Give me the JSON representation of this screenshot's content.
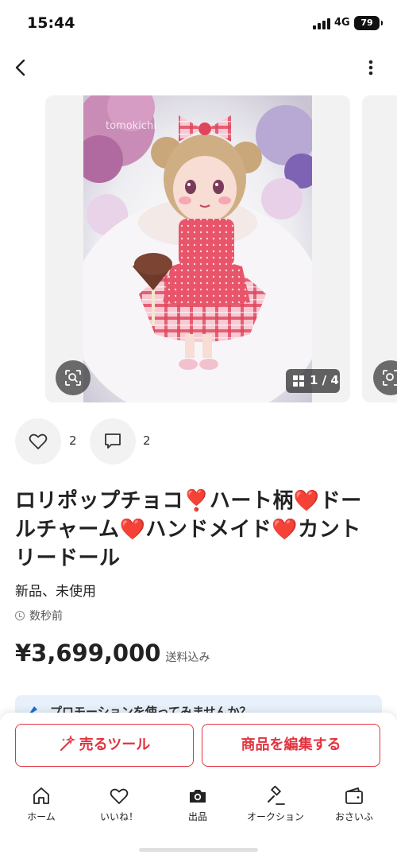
{
  "status_bar": {
    "time": "15:44",
    "network": "4G",
    "battery": "79"
  },
  "gallery": {
    "photo_watermark": "tomokichi",
    "counter": "1 / 4"
  },
  "reactions": {
    "likes": "2",
    "comments": "2"
  },
  "item": {
    "title_parts": [
      "ロリポップチョコ",
      "❣️",
      "ハート柄",
      "❤️",
      "ドールチャーム",
      "❤️",
      "ハンドメイド",
      "❤️",
      "カントリードール"
    ],
    "condition": "新品、未使用",
    "posted": "数秒前",
    "price": "¥3,699,000",
    "shipping": "送料込み"
  },
  "promo": {
    "text": "プロモーションを使ってみませんか？"
  },
  "actions": {
    "sell_tool": "売るツール",
    "edit_item": "商品を編集する"
  },
  "tabbar": [
    {
      "label": "ホーム",
      "icon": "home-icon"
    },
    {
      "label": "いいね！",
      "icon": "heart-icon"
    },
    {
      "label": "出品",
      "icon": "camera-icon"
    },
    {
      "label": "オークション",
      "icon": "gavel-icon"
    },
    {
      "label": "おさいふ",
      "icon": "wallet-icon"
    }
  ],
  "colors": {
    "accent": "#e2333f",
    "heart": "#e6222f",
    "promo_bg": "#e8f1fb"
  }
}
